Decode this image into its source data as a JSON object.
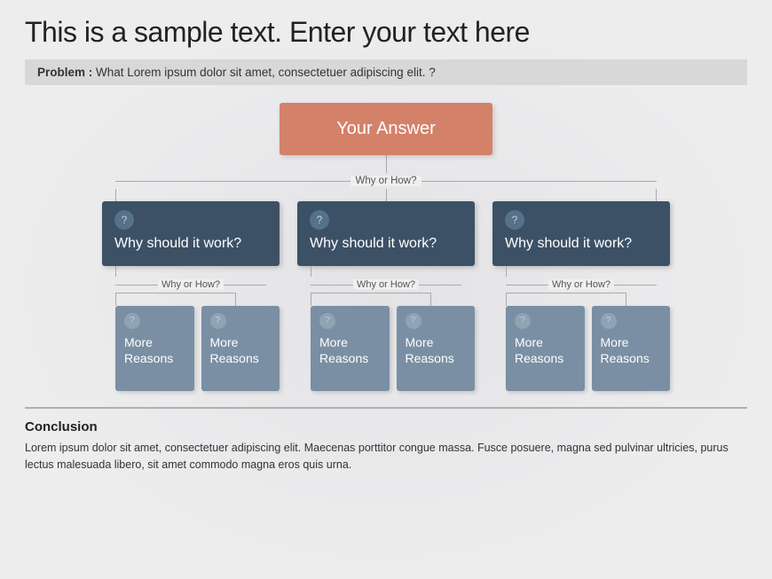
{
  "title": "This is a sample text. Enter your text here",
  "problem": {
    "label": "Problem :",
    "text": "What Lorem ipsum dolor sit amet, consectetuer adipiscing elit. ?"
  },
  "diagram": {
    "top_box": {
      "text": "Your Answer"
    },
    "connector_label": "Why or How?",
    "middle_boxes": [
      {
        "text": "Why should it work?"
      },
      {
        "text": "Why should it work?"
      },
      {
        "text": "Why should it work?"
      }
    ],
    "why_how_label": "Why or How?",
    "bottom_boxes": [
      {
        "text": "More\nReasons"
      },
      {
        "text": "More\nReasons"
      },
      {
        "text": "More\nReasons"
      },
      {
        "text": "More\nReasons"
      },
      {
        "text": "More\nReasons"
      },
      {
        "text": "More\nReasons"
      }
    ],
    "question_mark": "?"
  },
  "conclusion": {
    "title": "Conclusion",
    "text": "Lorem ipsum dolor sit amet, consectetuer adipiscing elit. Maecenas porttitor congue massa. Fusce posuere, magna sed pulvinar ultricies, purus lectus malesuada libero, sit amet commodo magna eros quis urna."
  }
}
